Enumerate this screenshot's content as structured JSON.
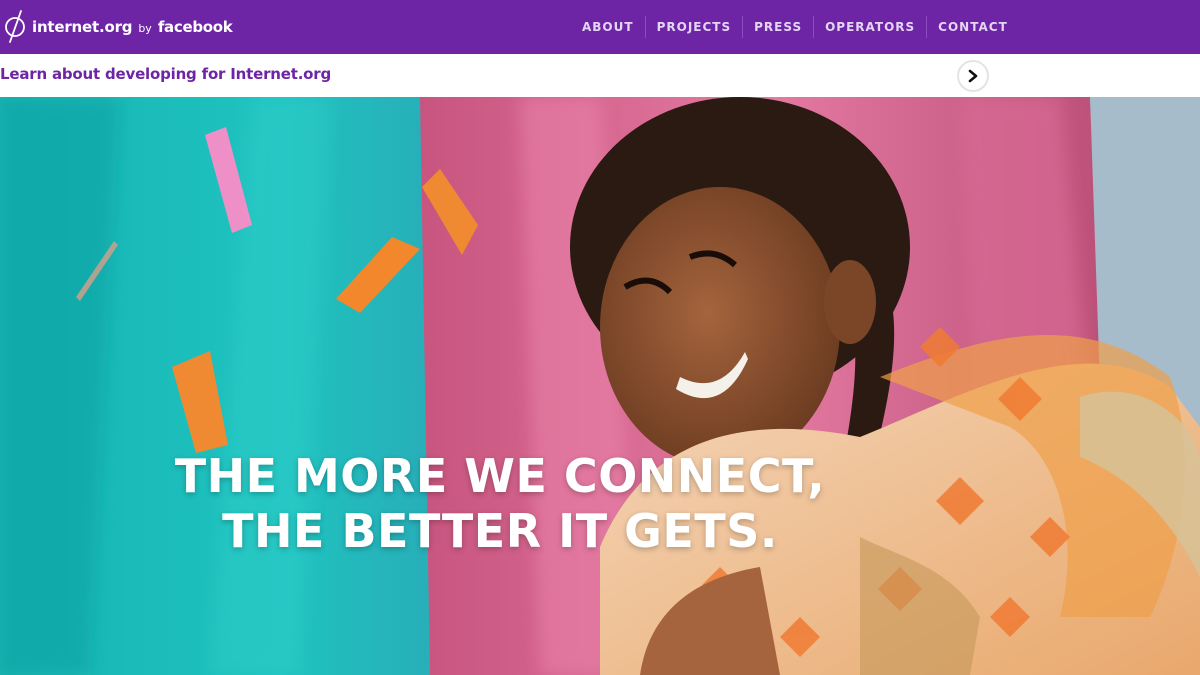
{
  "colors": {
    "brand_purple": "#6d25a6",
    "nav_text": "#e4d6f2",
    "headline_text": "#ffffff"
  },
  "header": {
    "logo_icon": "internet-org-logo-icon",
    "brand_name": "internet.org",
    "brand_by": "by",
    "brand_partner": "facebook",
    "nav": [
      "ABOUT",
      "PROJECTS",
      "PRESS",
      "OPERATORS",
      "CONTACT"
    ]
  },
  "devbar": {
    "link_text": "Learn about developing for Internet.org",
    "arrow_icon": "chevron-right-icon"
  },
  "hero": {
    "headline_line1": "THE MORE WE CONNECT,",
    "headline_line2": "THE BETTER IT GETS."
  }
}
